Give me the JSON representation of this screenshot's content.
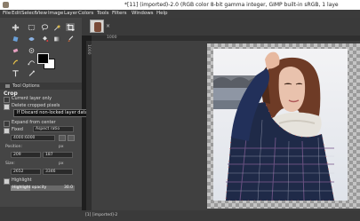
{
  "window": {
    "title": "*[11] (imported)-2.0 (RGB color 8-bit gamma integer, GIMP built-in sRGB, 1 laye"
  },
  "menubar": [
    "File",
    "Edit",
    "Select",
    "View",
    "Image",
    "Layer",
    "Colors",
    "Tools",
    "Filters",
    "Windows",
    "Help"
  ],
  "toolbox": {
    "tools": [
      "move-icon",
      "rect-select-icon",
      "lasso-icon",
      "fuzzy-select-icon",
      "crop-icon",
      "unified-transform-icon",
      "warp-icon",
      "bucket-fill-icon",
      "gradient-icon",
      "paintbrush-icon",
      "eraser-icon",
      "clone-icon",
      "smudge-icon",
      "path-icon",
      "text-icon",
      "color-picker-icon",
      "zoom-icon",
      "measure-icon"
    ]
  },
  "tool_options": {
    "tab_label": "Tool Options",
    "title": "Crop",
    "current_layer_only": "Current layer only",
    "delete_cropped": "Delete cropped pixels",
    "tooltip": "If Discard non-locked layer data that falls out of the crop region",
    "expand_from_center": "Expand from center",
    "fixed_label": "Fixed",
    "aspect_ratio": "Aspect ratio",
    "ratio_value": "4000:6000",
    "position_label": "Position:",
    "position_unit": "px",
    "pos_x": "209",
    "pos_y": "187",
    "size_label": "Size:",
    "size_unit": "px",
    "size_w": "2652",
    "size_h": "3346",
    "highlight_label": "Highlight",
    "highlight_opacity_label": "Highlight opacity",
    "highlight_opacity_value": "30.0",
    "highlight_opacity_fraction": 0.3
  },
  "image_tab": {
    "close": "×"
  },
  "rulers": {
    "h_label": "1000",
    "v_label": "1000"
  },
  "statusbar": {
    "text": "[1] [imported]-2"
  },
  "colors": {
    "accent": "#6a6a6a",
    "foreground": "#000000",
    "background": "#ffffff"
  }
}
